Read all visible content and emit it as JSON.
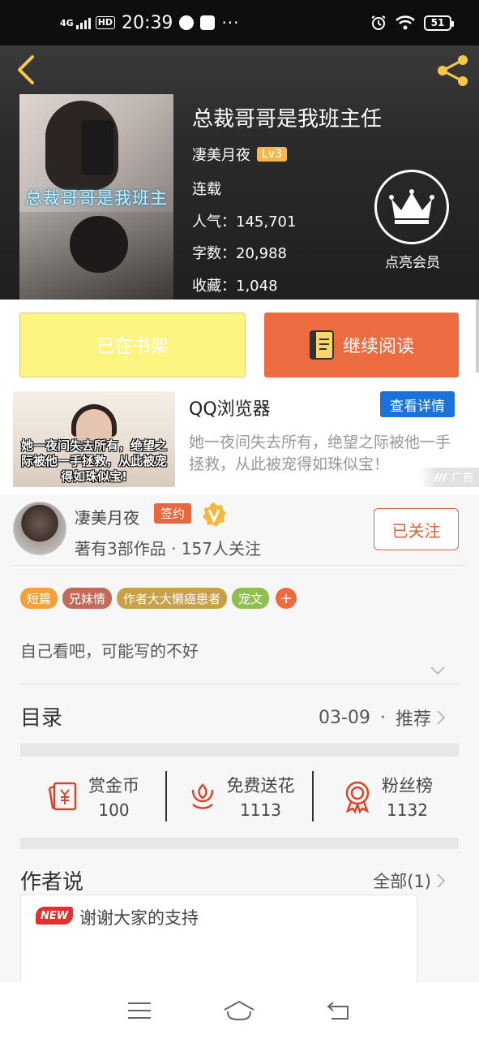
{
  "status_bar": {
    "network": "4G",
    "hd": "HD",
    "time": "20:39",
    "more": "···",
    "battery": "51"
  },
  "book": {
    "title": "总裁哥哥是我班主任",
    "author": "凄美月夜",
    "author_level": "Lv3",
    "status": "连载",
    "popularity_label": "人气：",
    "popularity": "145,701",
    "word_count_label": "字数：",
    "word_count": "20,988",
    "favorites_label": "收藏：",
    "favorites": "1,048",
    "cover_caption": "总裁哥哥是我班主任"
  },
  "vip": {
    "label": "点亮会员"
  },
  "actions": {
    "shelf_label": "已在书架",
    "read_label": "继续阅读"
  },
  "ad": {
    "title": "QQ浏览器",
    "button": "查看详情",
    "description": "她一夜间失去所有，绝望之际被他一手拯救，从此被宠得如珠似宝！",
    "image_caption": "她一夜间失去所有，绝望之际被他一手拯救，从此被宠得如珠似宝!",
    "tag": "广告"
  },
  "author": {
    "name": "凄美月夜",
    "signed_badge": "签约",
    "info": "著有3部作品 · 157人关注",
    "follow_label": "已关注"
  },
  "tags": [
    {
      "label": "短篇",
      "color": "#f3a23a"
    },
    {
      "label": "兄妹情",
      "color": "#c16a58"
    },
    {
      "label": "作者大大懒癌患者",
      "color": "#c9a04a"
    },
    {
      "label": "宠文",
      "color": "#8fbf4f"
    }
  ],
  "tag_more": "+",
  "intro": "自己看吧，可能写的不好",
  "toc": {
    "label": "目录",
    "date": "03-09",
    "separator": "·",
    "recommend": "推荐"
  },
  "stats": [
    {
      "label": "赏金币",
      "value": "100",
      "icon": "red-envelope-icon"
    },
    {
      "label": "免费送花",
      "value": "1113",
      "icon": "flower-icon"
    },
    {
      "label": "粉丝榜",
      "value": "1132",
      "icon": "medal-icon"
    }
  ],
  "author_says": {
    "label": "作者说",
    "all_label": "全部(1)",
    "new_badge": "NEW",
    "message": "谢谢大家的支持"
  },
  "colors": {
    "accent": "#ec6b40",
    "shelf_button": "#fcf582",
    "ad_button": "#1a73d9",
    "level_badge": "#f5b84a"
  }
}
